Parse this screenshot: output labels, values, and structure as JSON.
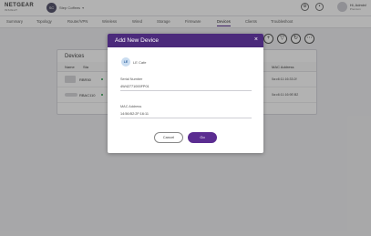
{
  "header": {
    "brand": "NETGEAR",
    "brand_sub": "INSIGHT",
    "org_initials": "SC",
    "org_name": "Step Coffees",
    "icons": [
      "gear-icon",
      "bell-icon"
    ],
    "user_name": "Hi, Admin!",
    "user_role": "Premium"
  },
  "tabs": [
    {
      "label": "Summary"
    },
    {
      "label": "Topology"
    },
    {
      "label": "Router/VPN"
    },
    {
      "label": "Wireless"
    },
    {
      "label": "Wired"
    },
    {
      "label": "Storage"
    },
    {
      "label": "Firmware"
    },
    {
      "label": "Devices",
      "active": true
    },
    {
      "label": "Clients"
    },
    {
      "label": "Troubleshoot"
    }
  ],
  "devices_card": {
    "title": "Devices",
    "columns": [
      "Name",
      "Sta",
      "MAC Address"
    ],
    "rows": [
      {
        "name": "RBR50",
        "mac": "0a:c6:11:16:33:2f"
      },
      {
        "name": "RBAC110",
        "mac": "0a:c6:11:16:9E:B2"
      }
    ]
  },
  "modal": {
    "title": "Add New Device",
    "close_glyph": "×",
    "device_type_initials": "LE",
    "device_type_label": "LE Cafe",
    "serial_label": "Serial Number",
    "serial_value": "4W42771000FP01",
    "mac_label": "MAC Address",
    "mac_value": "14:56:B2:2F:16:11",
    "cancel_label": "Cancel",
    "go_label": "Go"
  },
  "colors": {
    "header_purple": "#4b2a7b",
    "button_purple": "#5b2d91",
    "status_green": "#2e9e4f"
  }
}
